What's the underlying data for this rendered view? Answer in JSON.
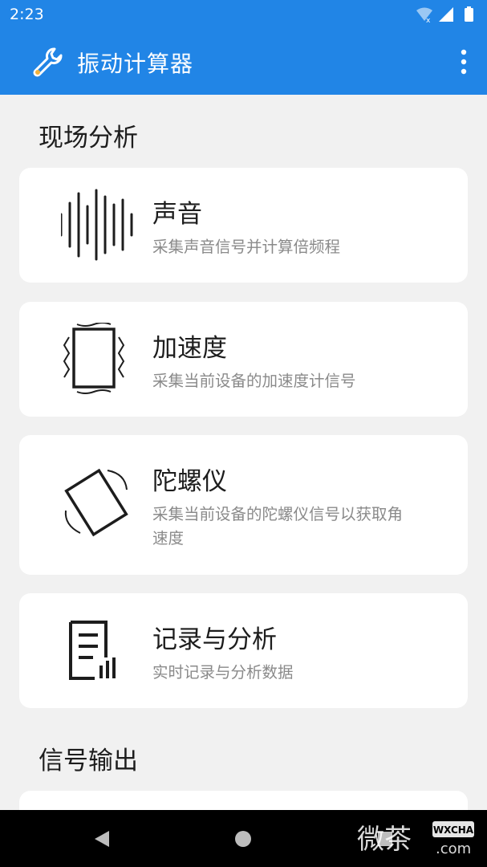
{
  "status_bar": {
    "time": "2:23"
  },
  "app_bar": {
    "title": "振动计算器"
  },
  "sections": [
    {
      "title": "现场分析"
    },
    {
      "title": "信号输出"
    }
  ],
  "cards": [
    {
      "title": "声音",
      "description": "采集声音信号并计算倍频程",
      "icon": "sound-wave-icon"
    },
    {
      "title": "加速度",
      "description": "采集当前设备的加速度计信号",
      "icon": "vibrating-phone-icon"
    },
    {
      "title": "陀螺仪",
      "description": "采集当前设备的陀螺仪信号以获取角速度",
      "icon": "rotating-phone-icon"
    },
    {
      "title": "记录与分析",
      "description": "实时记录与分析数据",
      "icon": "document-chart-icon"
    }
  ],
  "watermark": {
    "chinese": "微茶",
    "latin": "WXCHA",
    "domain": ".com"
  },
  "colors": {
    "primary": "#2185e6",
    "background": "#f1f1f1",
    "card": "#ffffff",
    "secondary_text": "#8a8a8a"
  }
}
